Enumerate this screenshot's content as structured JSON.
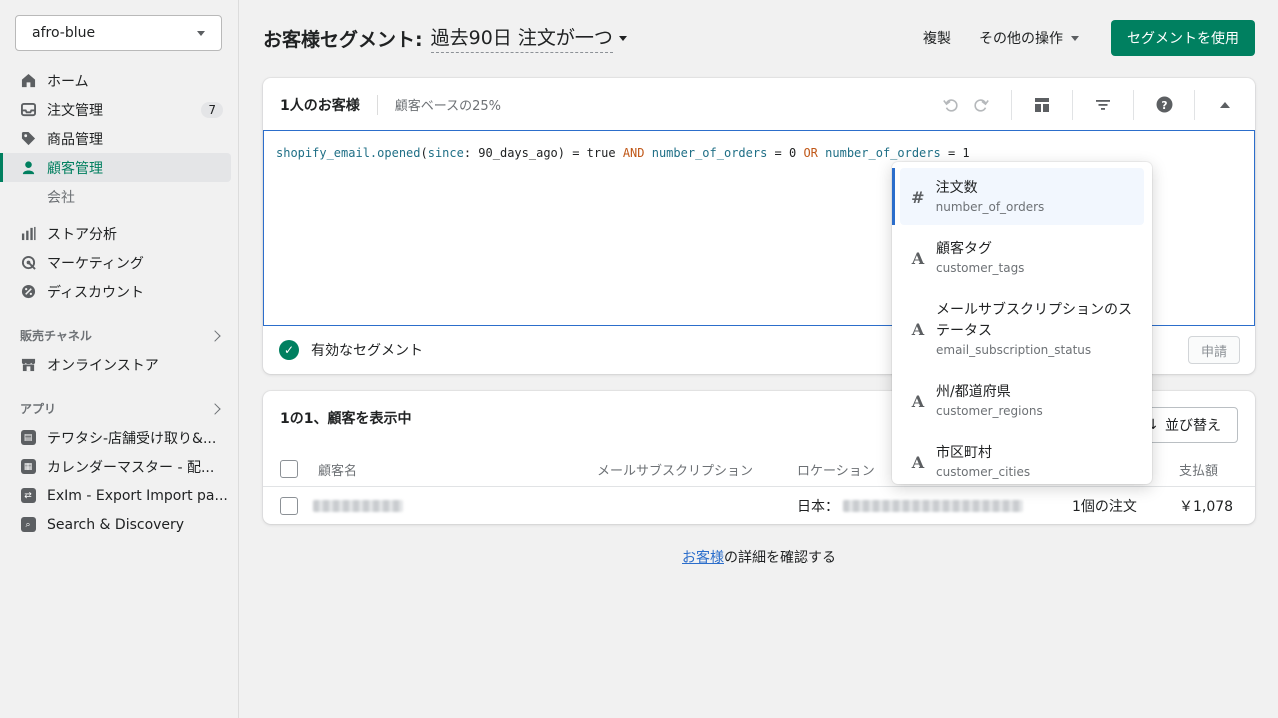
{
  "sidebar": {
    "store": "afro-blue",
    "items": [
      {
        "label": "ホーム"
      },
      {
        "label": "注文管理",
        "badge": "7"
      },
      {
        "label": "商品管理"
      },
      {
        "label": "顧客管理"
      },
      {
        "label": "会社"
      },
      {
        "label": "ストア分析"
      },
      {
        "label": "マーケティング"
      },
      {
        "label": "ディスカウント"
      }
    ],
    "sales_channels_label": "販売チャネル",
    "online_store": "オンラインストア",
    "apps_label": "アプリ",
    "apps": [
      {
        "label": "テワタシ-店舗受け取り&..."
      },
      {
        "label": "カレンダーマスター - 配..."
      },
      {
        "label": "ExIm - Export Import pa..."
      },
      {
        "label": "Search & Discovery"
      }
    ]
  },
  "header": {
    "title": "お客様セグメント:",
    "segment_name": "過去90日 注文が一つ",
    "duplicate": "複製",
    "more_actions": "その他の操作",
    "use_segment": "セグメントを使用"
  },
  "editor": {
    "count_title": "1人のお客様",
    "percentage": "顧客ベースの25%",
    "query": {
      "fn": "shopify_email.opened",
      "p1": "(",
      "attr_since": "since",
      "colon": ": 90_days_ago) = true ",
      "and": "AND",
      "part2a": " ",
      "field1": "number_of_orders",
      "part2b": " = 0 ",
      "or": "OR",
      "part3a": " ",
      "field2": "number_of_orders",
      "part3b": " = 1"
    },
    "valid_text": "有効なセグメント",
    "apply": "申請"
  },
  "dropdown": {
    "items": [
      {
        "icon": "#",
        "label": "注文数",
        "key": "number_of_orders"
      },
      {
        "icon": "A",
        "label": "顧客タグ",
        "key": "customer_tags"
      },
      {
        "icon": "A",
        "label": "メールサブスクリプションのステータス",
        "key": "email_subscription_status"
      },
      {
        "icon": "A",
        "label": "州/都道府県",
        "key": "customer_regions"
      },
      {
        "icon": "A",
        "label": "市区町村",
        "key": "customer_cities"
      }
    ]
  },
  "customers": {
    "heading": "1の1、顧客を表示中",
    "sort": "並び替え",
    "columns": {
      "name": "顧客名",
      "email": "メールサブスクリプション",
      "location": "ロケーション",
      "amount": "支払額"
    },
    "row": {
      "location_prefix": "日本：",
      "orders": "1個の注文",
      "amount": "￥1,078"
    }
  },
  "footer": {
    "link": "お客様",
    "rest": "の詳細を確認する"
  }
}
